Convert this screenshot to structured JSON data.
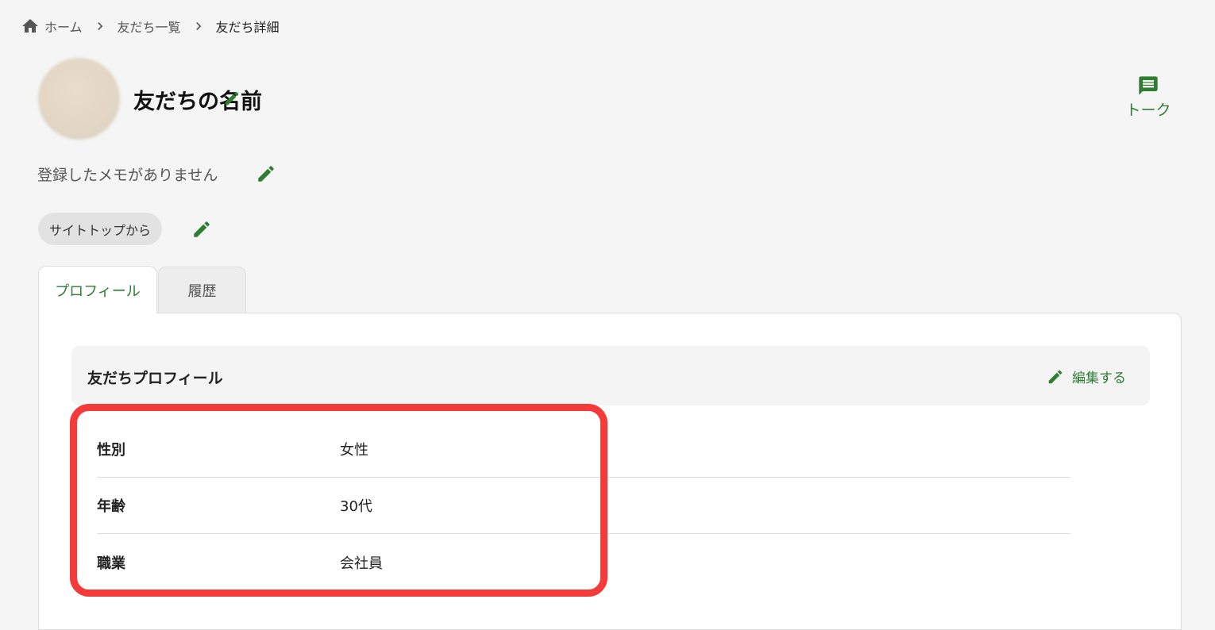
{
  "breadcrumb": {
    "home": "ホーム",
    "list": "友だち一覧",
    "current": "友だち詳細"
  },
  "profile": {
    "name": "友だちの名前",
    "memo": "登録したメモがありません",
    "tag": "サイトトップから"
  },
  "actions": {
    "talk_label": "トーク"
  },
  "tabs": [
    {
      "label": "プロフィール",
      "active": true
    },
    {
      "label": "履歴",
      "active": false
    }
  ],
  "panel": {
    "title": "友だちプロフィール",
    "edit_label": "編集する",
    "rows": [
      {
        "key": "性別",
        "value": "女性"
      },
      {
        "key": "年齢",
        "value": "30代"
      },
      {
        "key": "職業",
        "value": "会社員"
      }
    ]
  },
  "colors": {
    "accent": "#2e7d32",
    "highlight": "#f53a3a",
    "background": "#f5f5f5"
  }
}
